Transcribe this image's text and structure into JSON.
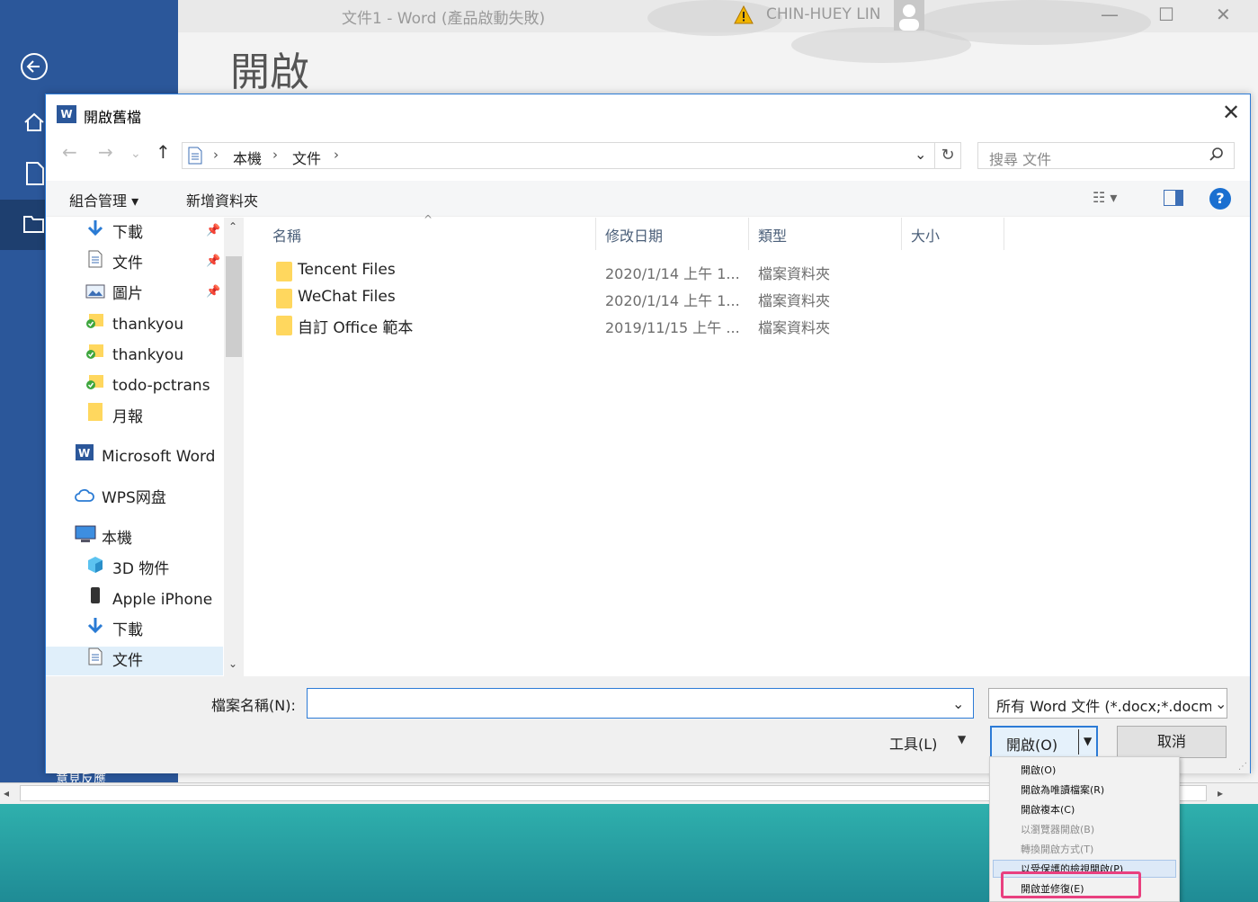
{
  "word_window": {
    "title": "文件1 - Word (產品啟動失敗)",
    "user_name": "CHIN-HUEY LIN",
    "heading": "開啟",
    "rail_bottom_label": "意見反應",
    "icons": [
      "back-arrow-icon",
      "home-icon",
      "new-document-icon",
      "open-folder-icon"
    ],
    "window_buttons": [
      "—",
      "☐",
      "✕"
    ]
  },
  "dialog": {
    "title": "開啟舊檔",
    "close_label": "✕",
    "nav": {
      "back": "←",
      "forward": "→",
      "recent": "⌄",
      "up": "↑"
    },
    "address": {
      "crumbs": [
        "本機",
        "文件"
      ],
      "separator": "›"
    },
    "refresh": "↻",
    "search_placeholder": "搜尋 文件",
    "commands": {
      "organize": "組合管理 ▾",
      "new_folder": "新增資料夾",
      "view": "☷ ▾",
      "pane": "▯",
      "help": "?"
    },
    "nav_pane": [
      {
        "label": "下載",
        "icon": "download-icon",
        "pinned": true
      },
      {
        "label": "文件",
        "icon": "document-icon",
        "pinned": true
      },
      {
        "label": "圖片",
        "icon": "picture-icon",
        "pinned": true
      },
      {
        "label": "thankyou",
        "icon": "synced-folder-icon",
        "pinned": false
      },
      {
        "label": "thankyou",
        "icon": "synced-folder-icon",
        "pinned": false
      },
      {
        "label": "todo-pctrans",
        "icon": "synced-folder-icon",
        "pinned": false
      },
      {
        "label": "月報",
        "icon": "folder-icon",
        "pinned": false
      },
      {
        "label": "Microsoft Word",
        "icon": "word-icon",
        "pinned": false
      },
      {
        "label": "WPS网盘",
        "icon": "cloud-icon",
        "pinned": false
      },
      {
        "label": "本機",
        "icon": "computer-icon",
        "pinned": false
      },
      {
        "label": "3D 物件",
        "icon": "cube-icon",
        "pinned": false
      },
      {
        "label": "Apple iPhone",
        "icon": "phone-icon",
        "pinned": false
      },
      {
        "label": "下載",
        "icon": "download-icon",
        "pinned": false
      },
      {
        "label": "文件",
        "icon": "document-icon",
        "pinned": false
      }
    ],
    "columns": [
      "名稱",
      "修改日期",
      "類型",
      "大小"
    ],
    "files": [
      {
        "name": "Tencent Files",
        "modified": "2020/1/14 上午 1...",
        "type": "檔案資料夾",
        "size": ""
      },
      {
        "name": "WeChat Files",
        "modified": "2020/1/14 上午 1...",
        "type": "檔案資料夾",
        "size": ""
      },
      {
        "name": "自訂 Office 範本",
        "modified": "2019/11/15 上午 ...",
        "type": "檔案資料夾",
        "size": ""
      }
    ],
    "filename_label": "檔案名稱(N):",
    "filename_value": "",
    "filter": "所有 Word 文件 (*.docx;*.docm",
    "tools_label": "工具(L)",
    "open_button": "開啟(O)",
    "cancel_button": "取消"
  },
  "open_menu": [
    {
      "label": "開啟(O)",
      "enabled": true
    },
    {
      "label": "開啟為唯讀檔案(R)",
      "enabled": true
    },
    {
      "label": "開啟複本(C)",
      "enabled": true
    },
    {
      "label": "以瀏覽器開啟(B)",
      "enabled": false
    },
    {
      "label": "轉換開啟方式(T)",
      "enabled": false
    },
    {
      "label": "以受保護的檢視開啟(P)",
      "enabled": true
    },
    {
      "label": "開啟並修復(E)",
      "enabled": true
    }
  ],
  "colors": {
    "word_blue": "#2b579a",
    "accent": "#2c7bd6",
    "highlight": "#e9407f",
    "folder": "#ffd75e"
  }
}
